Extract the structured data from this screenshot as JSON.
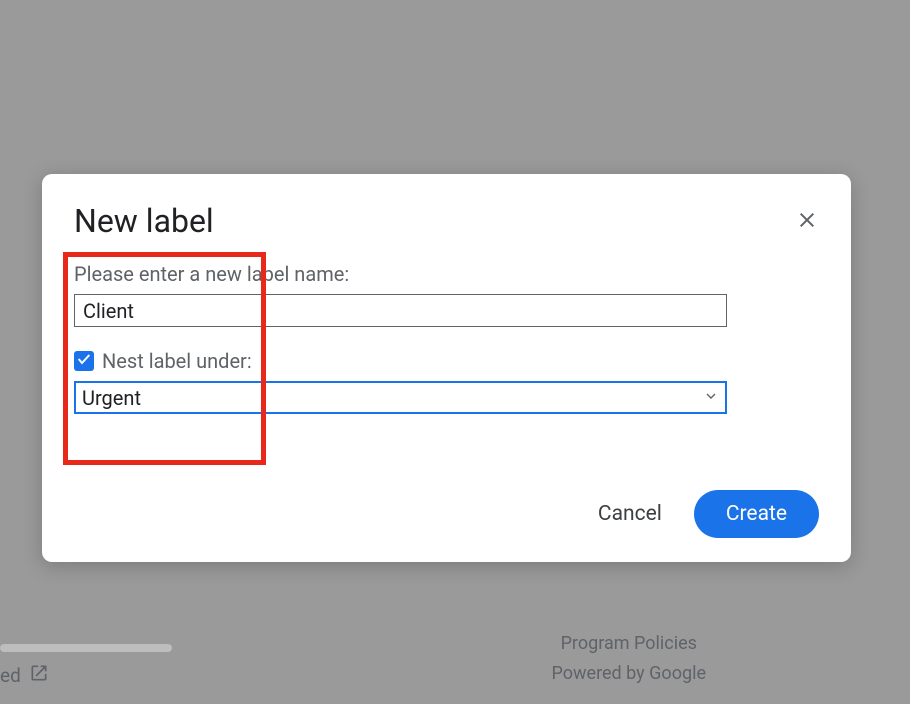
{
  "dialog": {
    "title": "New label",
    "prompt": "Please enter a new label name:",
    "label_name_value": "Client",
    "nest_checkbox_checked": true,
    "nest_label": "Nest label under:",
    "parent_selected": "Urgent",
    "cancel_label": "Cancel",
    "create_label": "Create"
  },
  "footer": {
    "policies": "Program Policies",
    "powered": "Powered by Google",
    "left_text": "ed"
  }
}
